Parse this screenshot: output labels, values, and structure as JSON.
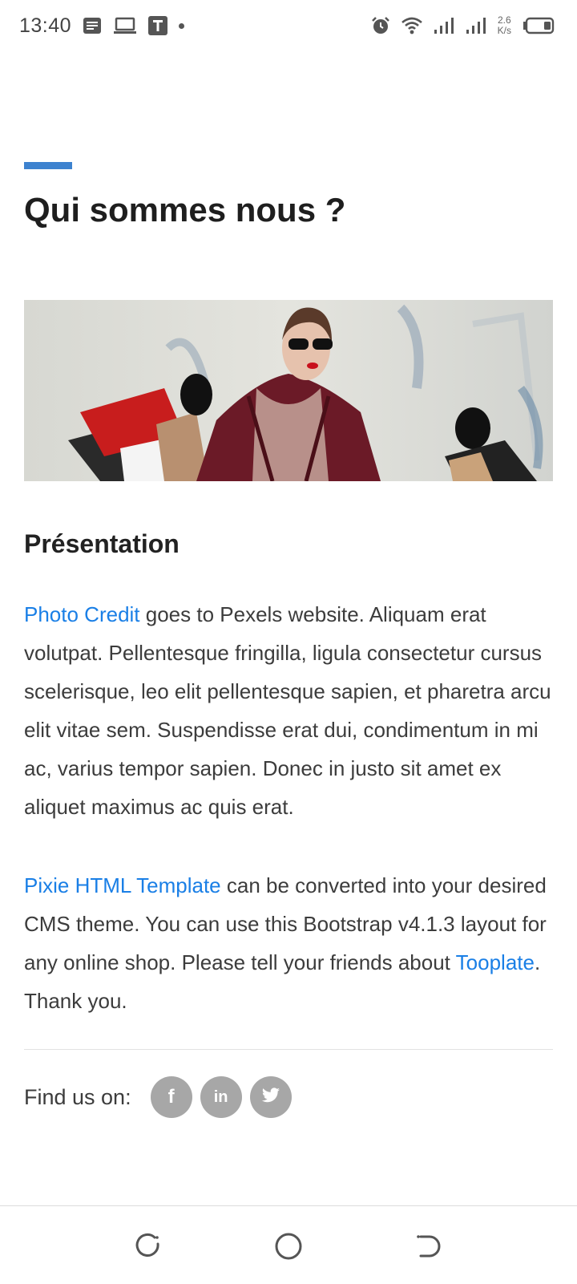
{
  "status_bar": {
    "time": "13:40",
    "net_speed_value": "2.6",
    "net_speed_unit": "K/s",
    "icons": [
      "notes-icon",
      "laptop-icon",
      "t-app-icon",
      "notification-dot",
      "alarm-icon",
      "wifi-icon",
      "signal-icon",
      "signal-icon",
      "battery-icon"
    ]
  },
  "page": {
    "title": "Qui sommes nous ?",
    "accent_color": "#3d82cf",
    "hero_image_alt": "woman with shopping bags"
  },
  "presentation": {
    "heading": "Présentation",
    "p1_link": "Photo Credit",
    "p1_text": " goes to Pexels website. Aliquam erat volutpat. Pellentesque fringilla, ligula consectetur cursus scelerisque, leo elit pellentesque sapien, et pharetra arcu elit vitae sem. Suspendisse erat dui, condimentum in mi ac, varius tempor sapien. Donec in justo sit amet ex aliquet maximus ac quis erat.",
    "p2_link": "Pixie HTML Template",
    "p2_text": " can be converted into your desired CMS theme. You can use this Bootstrap v4.1.3 layout for any online shop. Please tell your friends about ",
    "p2_link2": "Tooplate",
    "p2_end": ". Thank you.",
    "link_color": "#1a7fe6"
  },
  "social": {
    "label": "Find us on:",
    "networks": [
      "facebook-icon",
      "linkedin-icon",
      "twitter-icon"
    ],
    "facebook_glyph": "f",
    "linkedin_glyph": "in"
  },
  "nav_bar": {
    "buttons": [
      "recents-button",
      "home-button",
      "back-button"
    ]
  }
}
